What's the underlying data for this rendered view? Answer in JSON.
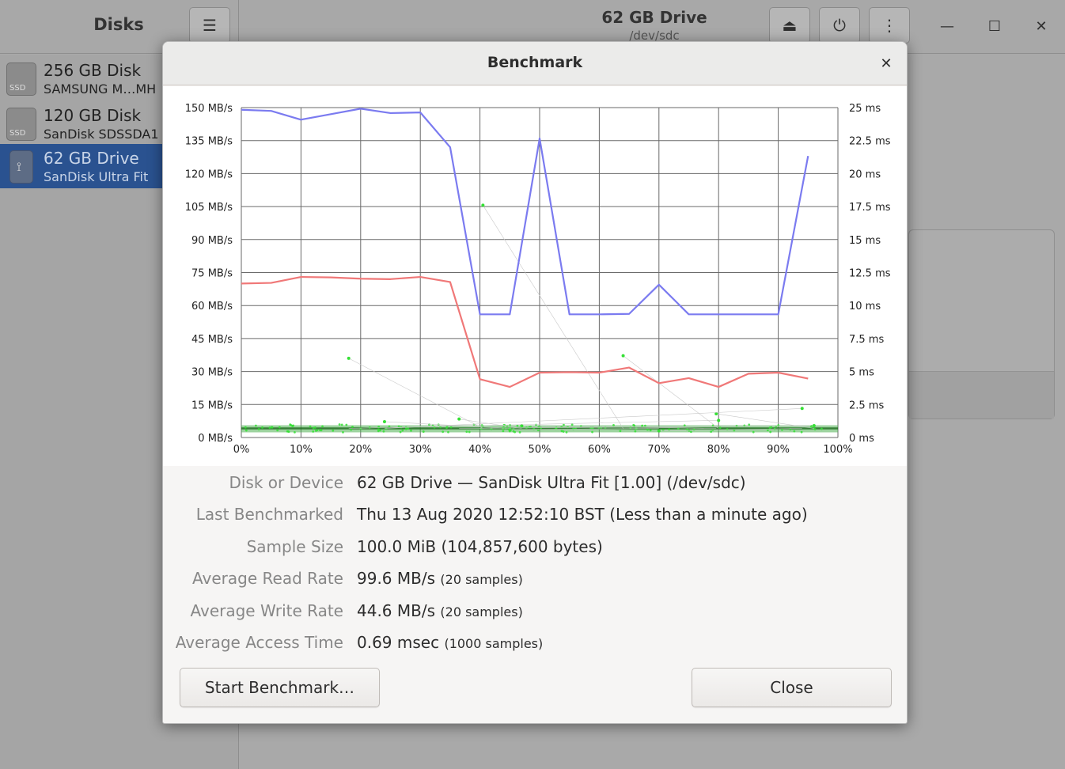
{
  "app": {
    "title": "Disks",
    "drive_title": "62 GB Drive",
    "drive_subtitle": "/dev/sdc"
  },
  "icons": {
    "menu": "☰",
    "eject": "⏏",
    "power": "⏻",
    "more": "⋮",
    "minimize": "—",
    "maximize": "☐",
    "close": "✕",
    "usb": "⟟"
  },
  "sidebar": {
    "items": [
      {
        "name": "256 GB Disk",
        "model": "SAMSUNG M…MH",
        "badge": "SSD"
      },
      {
        "name": "120 GB Disk",
        "model": "SanDisk SDSSDA1",
        "badge": "SSD"
      },
      {
        "name": "62 GB Drive",
        "model": "SanDisk Ultra Fit",
        "badge": ""
      }
    ]
  },
  "dialog": {
    "title": "Benchmark",
    "close_icon": "✕",
    "rows": [
      {
        "label": "Disk or Device",
        "value": "62 GB Drive — SanDisk Ultra Fit [1.00] (/dev/sdc)",
        "extra": ""
      },
      {
        "label": "Last Benchmarked",
        "value": "Thu 13 Aug 2020 12:52:10 BST (Less than a minute ago)",
        "extra": ""
      },
      {
        "label": "Sample Size",
        "value": "100.0 MiB (104,857,600 bytes)",
        "extra": ""
      },
      {
        "label": "Average Read Rate",
        "value": "99.6 MB/s",
        "extra": "(20 samples)"
      },
      {
        "label": "Average Write Rate",
        "value": "44.6 MB/s",
        "extra": "(20 samples)"
      },
      {
        "label": "Average Access Time",
        "value": "0.69 msec",
        "extra": "(1000 samples)"
      }
    ],
    "start_button": "Start Benchmark…",
    "close_button": "Close"
  },
  "colors": {
    "read": "#7b7bf0",
    "write": "#f07878",
    "access": "#35e035",
    "selection": "#2a5290"
  },
  "chart_data": {
    "type": "line",
    "x_unit": "%",
    "x_ticks": [
      "0%",
      "10%",
      "20%",
      "30%",
      "40%",
      "50%",
      "60%",
      "70%",
      "80%",
      "90%",
      "100%"
    ],
    "y_left_ticks": [
      "0 MB/s",
      "15 MB/s",
      "30 MB/s",
      "45 MB/s",
      "60 MB/s",
      "75 MB/s",
      "90 MB/s",
      "105 MB/s",
      "120 MB/s",
      "135 MB/s",
      "150 MB/s"
    ],
    "y_right_ticks": [
      "0 ms",
      "2.5 ms",
      "5 ms",
      "7.5 ms",
      "10 ms",
      "12.5 ms",
      "15 ms",
      "17.5 ms",
      "20 ms",
      "22.5 ms",
      "25 ms"
    ],
    "ylim_left": [
      0,
      150
    ],
    "ylim_right": [
      0,
      25
    ],
    "xlim": [
      0,
      100
    ],
    "grid": true,
    "series": [
      {
        "color": "#7b7bf0",
        "axis": "left",
        "x": [
          0,
          5,
          10,
          15,
          20,
          25,
          30,
          35,
          40,
          45,
          50,
          55,
          60,
          65,
          70,
          75,
          80,
          85,
          90,
          95
        ],
        "values": [
          149,
          148.5,
          144.5,
          147,
          149.5,
          147.5,
          147.8,
          132,
          56,
          56,
          136,
          56,
          56,
          56.2,
          69.5,
          56,
          56,
          56,
          56,
          128
        ]
      },
      {
        "color": "#f07878",
        "axis": "left",
        "x": [
          0,
          5,
          10,
          15,
          20,
          25,
          30,
          35,
          40,
          45,
          50,
          55,
          60,
          65,
          70,
          75,
          80,
          85,
          90,
          95
        ],
        "values": [
          70,
          70.3,
          73,
          72.8,
          72.2,
          72,
          73,
          70.7,
          26.5,
          23,
          29.5,
          29.7,
          29.5,
          31.8,
          24.7,
          27,
          23,
          29,
          29.5,
          26.8
        ]
      },
      {
        "color": "#35e035",
        "axis": "right",
        "type": "scatter",
        "x": [
          18,
          24,
          36.5,
          40.5,
          45,
          47,
          64,
          70,
          79.6,
          80,
          94,
          96
        ],
        "values": [
          6,
          1.2,
          1.4,
          17.6,
          0.6,
          0.9,
          6.2,
          0.5,
          1.8,
          1.3,
          2.2,
          0.9
        ],
        "baseline_ms": 0.69
      }
    ]
  }
}
